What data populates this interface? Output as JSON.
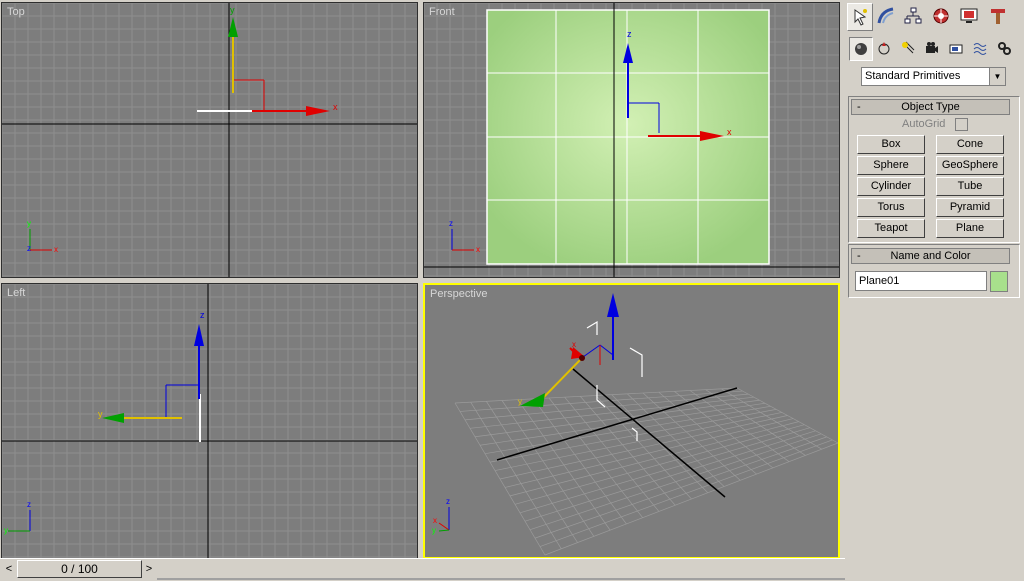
{
  "viewports": {
    "top": {
      "label": "Top"
    },
    "front": {
      "label": "Front"
    },
    "left": {
      "label": "Left"
    },
    "perspective": {
      "label": "Perspective"
    }
  },
  "axis_labels": {
    "x": "x",
    "y": "y",
    "z": "z"
  },
  "command_panel": {
    "tabs": [
      "create-icon",
      "modify-icon",
      "hierarchy-icon",
      "motion-icon",
      "display-icon",
      "utilities-icon"
    ],
    "subtabs": [
      "geometry-icon",
      "shapes-icon",
      "lights-icon",
      "cameras-icon",
      "helpers-icon",
      "space-warps-icon",
      "systems-icon"
    ],
    "category_dropdown": "Standard Primitives",
    "object_type": {
      "header": "Object Type",
      "collapse": "-",
      "autogrid": "AutoGrid",
      "buttons": [
        "Box",
        "Cone",
        "Sphere",
        "GeoSphere",
        "Cylinder",
        "Tube",
        "Torus",
        "Pyramid",
        "Teapot",
        "Plane"
      ]
    },
    "name_and_color": {
      "header": "Name and Color",
      "collapse": "-",
      "name": "Plane01",
      "color": "#a8e08c"
    }
  },
  "timeline": {
    "frame": "0 / 100",
    "prev": "<",
    "next": ">"
  },
  "colors": {
    "viewport_bg": "#7d7d7d",
    "grid": "#8e8e8e",
    "active_border": "#ffff00",
    "x_axis": "#e00000",
    "y_axis": "#00a000",
    "z_axis": "#0000e0",
    "plane": "#b8e09a"
  }
}
